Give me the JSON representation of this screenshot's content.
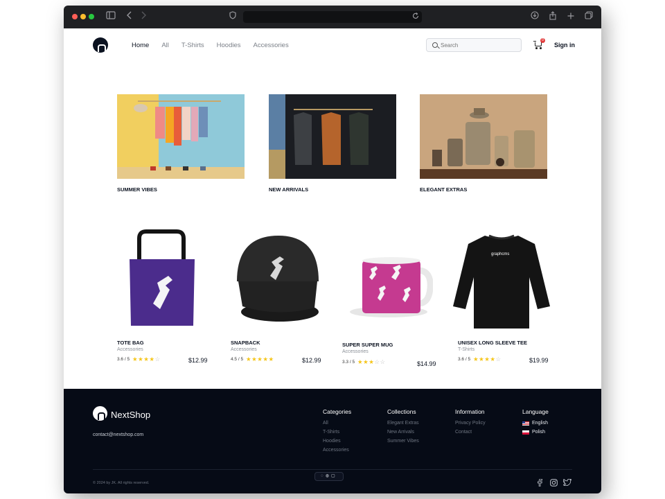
{
  "nav": {
    "items": [
      {
        "label": "Home",
        "active": true
      },
      {
        "label": "All",
        "active": false
      },
      {
        "label": "T-Shirts",
        "active": false
      },
      {
        "label": "Hoodies",
        "active": false
      },
      {
        "label": "Accessories",
        "active": false
      }
    ],
    "search_placeholder": "Search",
    "cart_count": "0",
    "signin": "Sign in"
  },
  "collections": [
    {
      "label": "SUMMER VIBES"
    },
    {
      "label": "NEW ARRIVALS"
    },
    {
      "label": "ELEGANT EXTRAS"
    }
  ],
  "products": [
    {
      "name": "TOTE BAG",
      "category": "Accessories",
      "rating": "3.6 / 5",
      "stars": 4,
      "price": "$12.99"
    },
    {
      "name": "SNAPBACK",
      "category": "Accessories",
      "rating": "4.5 / 5",
      "stars": 5,
      "price": "$12.99"
    },
    {
      "name": "SUPER SUPER MUG",
      "category": "Accessories",
      "rating": "3.3 / 5",
      "stars": 3,
      "price": "$14.99"
    },
    {
      "name": "UNISEX LONG SLEEVE TEE",
      "category": "T-Shirts",
      "rating": "3.6 / 5",
      "stars": 4,
      "price": "$19.99"
    }
  ],
  "shirt_print": "graphcms",
  "footer": {
    "brand": "NextShop",
    "email": "contact@nextshop.com",
    "categories": {
      "title": "Categories",
      "links": [
        "All",
        "T-Shirts",
        "Hoodies",
        "Accessories"
      ]
    },
    "collections": {
      "title": "Collections",
      "links": [
        "Elegant Extras",
        "New Arrivals",
        "Summer Vibes"
      ]
    },
    "information": {
      "title": "Information",
      "links": [
        "Privacy Policy",
        "Contact"
      ]
    },
    "language": {
      "title": "Language",
      "links": [
        "English",
        "Polish"
      ]
    },
    "copyright": "© 2024 by JK. All rights reserved.",
    "social_icons": [
      "facebook-icon",
      "instagram-icon",
      "twitter-icon"
    ]
  },
  "colors": {
    "brand_dark": "#0b1220",
    "footer_bg": "#060b16",
    "star": "#f5c518",
    "tote": "#4a2a8a",
    "mug": "#c2378e"
  }
}
